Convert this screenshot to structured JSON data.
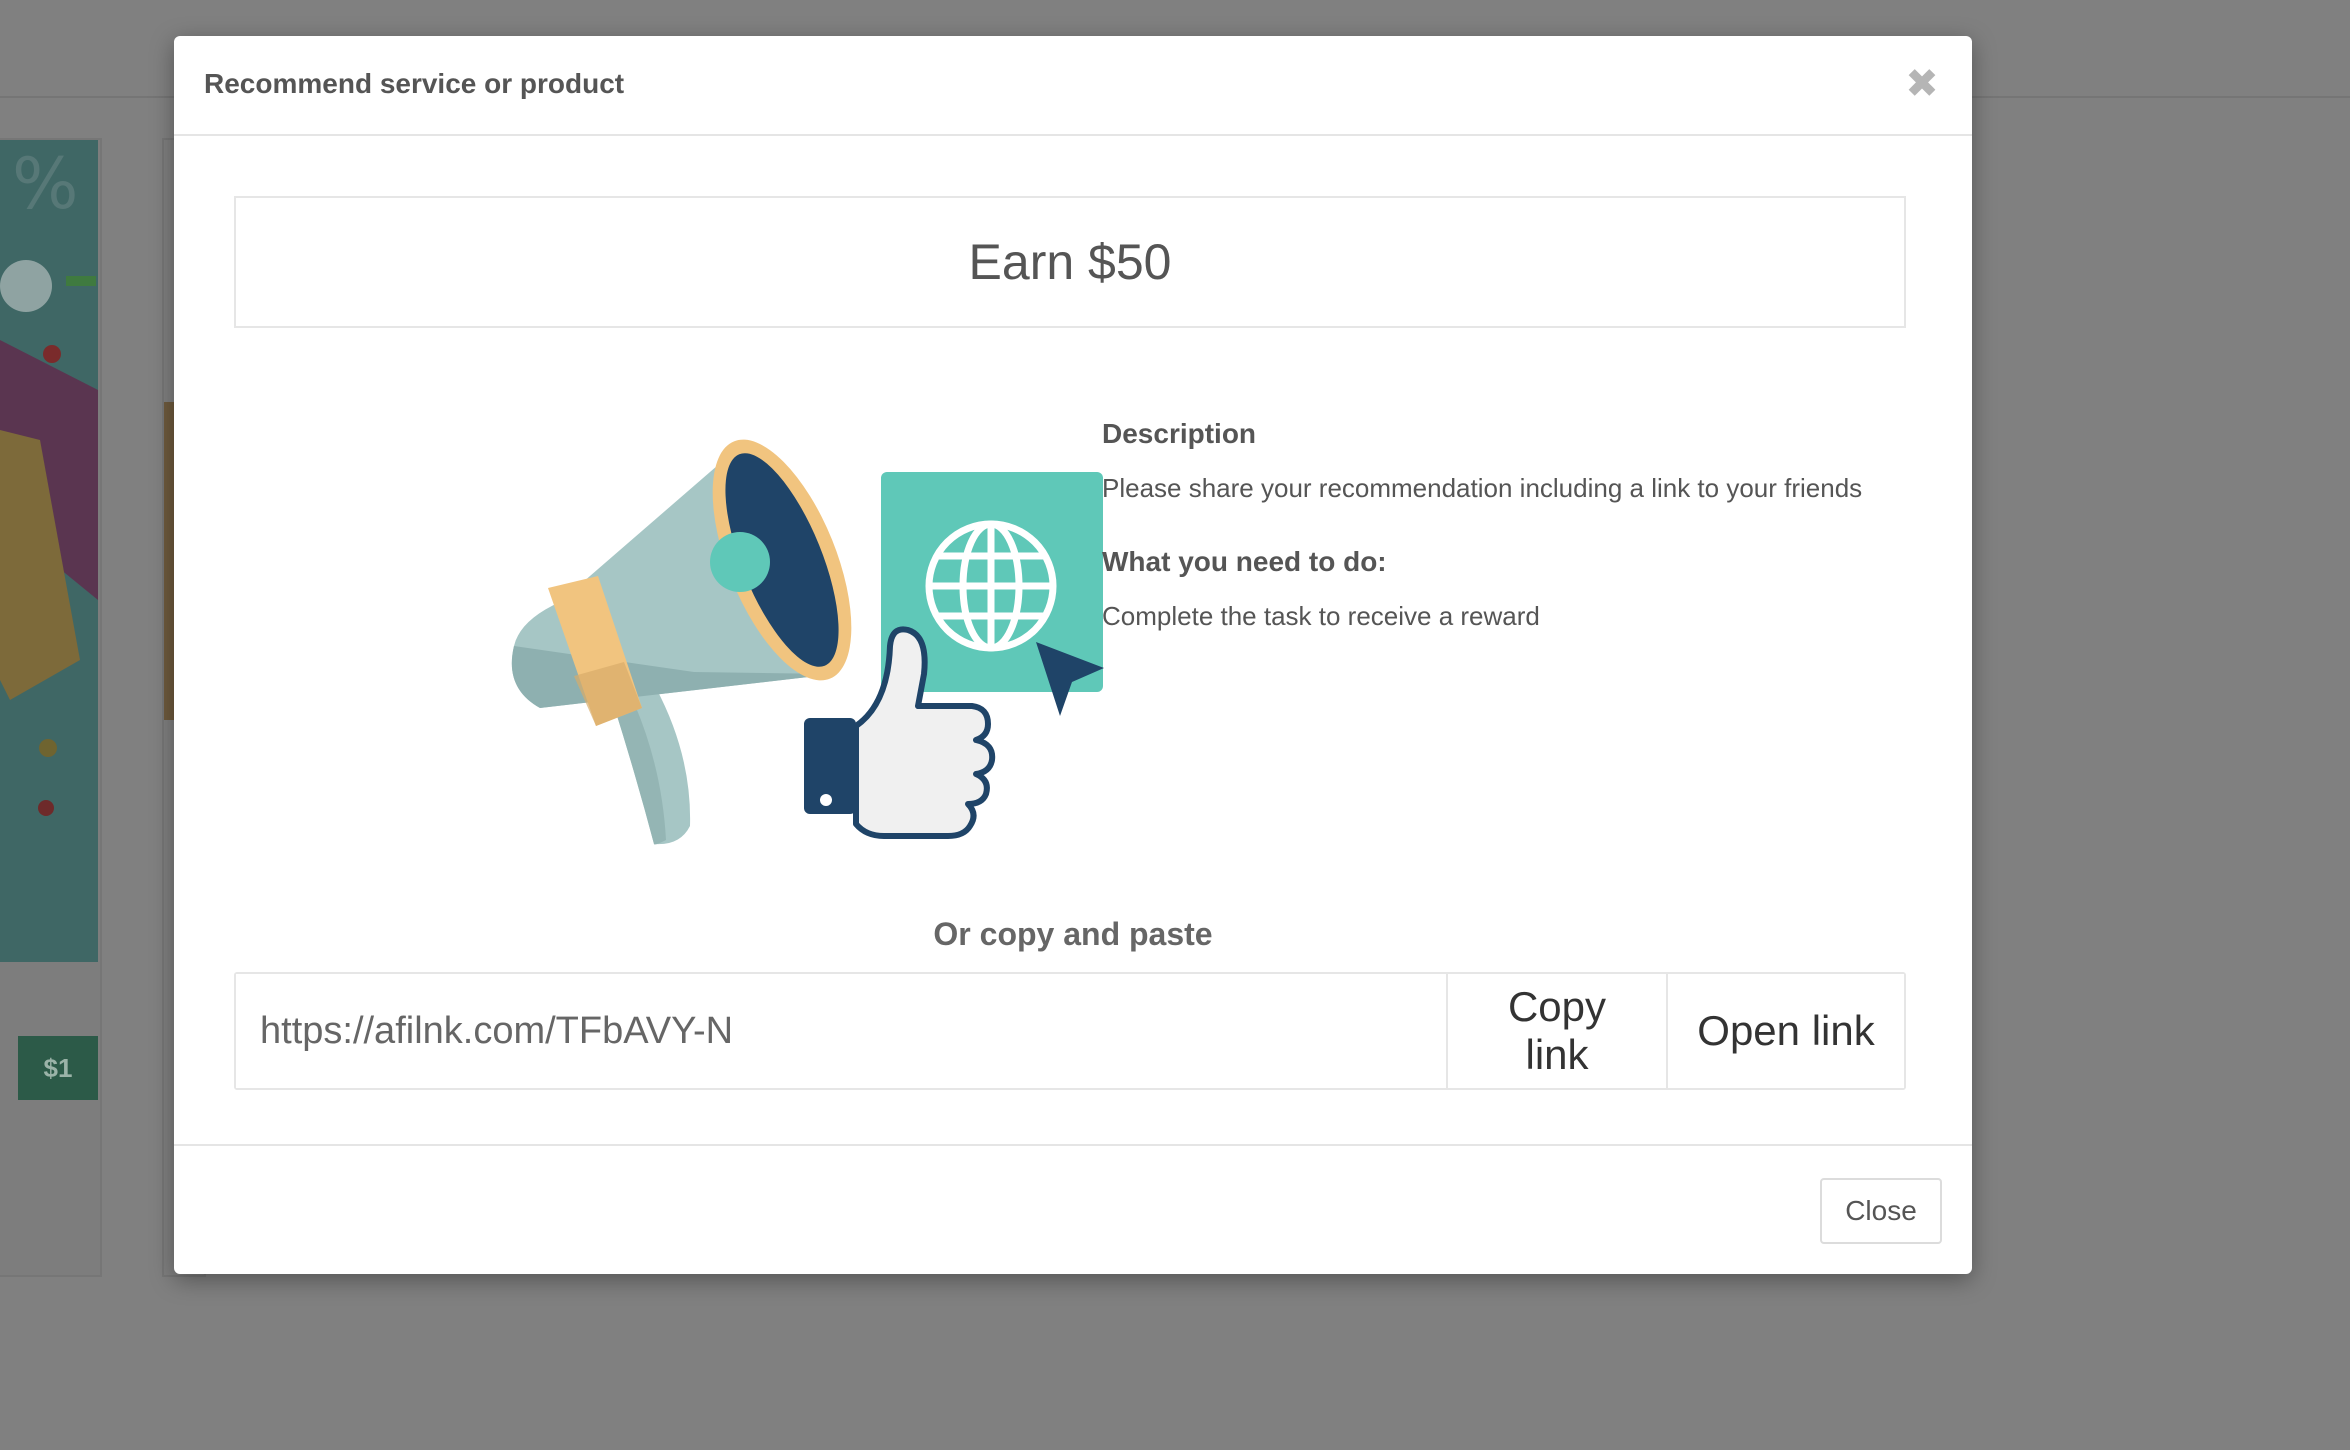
{
  "background": {
    "price_badge": "$1"
  },
  "modal": {
    "title": "Recommend service or product",
    "close_icon": "close-icon",
    "reward": "Earn $50",
    "description_heading": "Description",
    "description_text": "Please share your recommendation including a link to your friends",
    "task_heading": "What you need to do:",
    "task_text": "Complete the task to receive a reward",
    "copy_heading": "Or copy and paste",
    "link_value": "https://afilnk.com/TFbAVY-N",
    "copy_button": "Copy link",
    "open_button": "Open link",
    "footer_close": "Close"
  },
  "colors": {
    "overlay": "#808080",
    "teal": "#5fc8b8",
    "navy": "#1f4468",
    "peach": "#f1c47f",
    "megaphone": "#a6c6c5"
  }
}
